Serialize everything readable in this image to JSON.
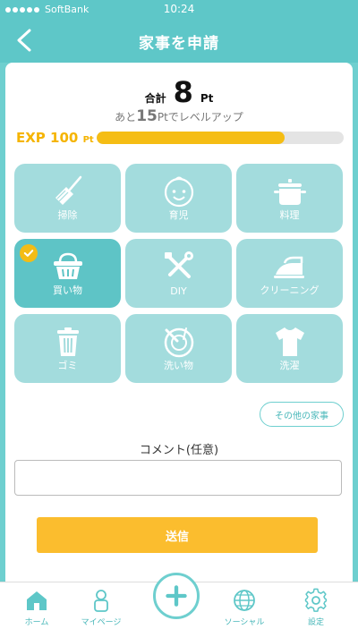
{
  "status_bar": {
    "carrier": "SoftBank",
    "time": "10:24"
  },
  "nav": {
    "title": "家事を申請"
  },
  "summary": {
    "total_label": "合計",
    "total_value": "8",
    "total_unit": "Pt",
    "levelup_prefix": "あと",
    "levelup_points": "15",
    "levelup_suffix": "Ptでレベルアップ"
  },
  "exp": {
    "label": "EXP 100",
    "unit": "Pt",
    "progress_fraction": 0.76
  },
  "chores": [
    {
      "label": "掃除",
      "icon": "broom-icon",
      "selected": false
    },
    {
      "label": "育児",
      "icon": "baby-icon",
      "selected": false
    },
    {
      "label": "料理",
      "icon": "pot-icon",
      "selected": false
    },
    {
      "label": "買い物",
      "icon": "basket-icon",
      "selected": true
    },
    {
      "label": "DIY",
      "icon": "tools-icon",
      "selected": false
    },
    {
      "label": "クリーニング",
      "icon": "iron-icon",
      "selected": false
    },
    {
      "label": "ゴミ",
      "icon": "trash-icon",
      "selected": false
    },
    {
      "label": "洗い物",
      "icon": "dish-icon",
      "selected": false
    },
    {
      "label": "洗濯",
      "icon": "shirt-icon",
      "selected": false
    }
  ],
  "other_button": "その他の家事",
  "comment": {
    "label": "コメント(任意)",
    "value": "",
    "placeholder": ""
  },
  "submit": "送信",
  "tabs": [
    {
      "label": "ホーム",
      "icon": "home-icon"
    },
    {
      "label": "マイページ",
      "icon": "person-icon"
    },
    {
      "label": "ソーシャル",
      "icon": "globe-icon"
    },
    {
      "label": "設定",
      "icon": "gear-icon"
    }
  ],
  "colors": {
    "teal": "#5ec7c8",
    "tile": "#a3dcdd",
    "tile_selected": "#5ec4c6",
    "accent": "#fbbd2e",
    "exp_text": "#f5b400"
  }
}
